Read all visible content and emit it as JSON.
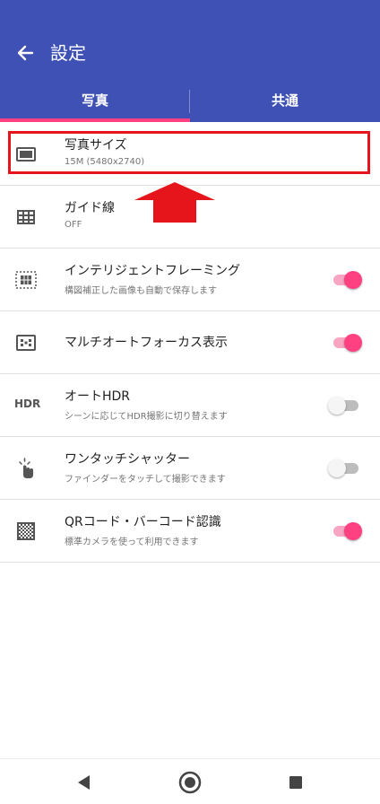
{
  "appbar": {
    "title": "設定",
    "bg_color": "#3f51b5",
    "accent_color": "#ff4081"
  },
  "tabs": [
    {
      "label": "写真",
      "selected": true
    },
    {
      "label": "共通",
      "selected": false
    }
  ],
  "settings": [
    {
      "title": "写真サイズ",
      "subtitle": "15M (5480x2740)",
      "icon": "image-size-icon",
      "toggle": null
    },
    {
      "title": "ガイド線",
      "subtitle": "OFF",
      "icon": "grid-lines-icon",
      "toggle": null
    },
    {
      "title": "インテリジェントフレーミング",
      "subtitle": "構図補正した画像も自動で保存します",
      "icon": "framing-icon",
      "toggle": true
    },
    {
      "title": "マルチオートフォーカス表示",
      "subtitle": "",
      "icon": "multi-af-icon",
      "toggle": true
    },
    {
      "title": "オートHDR",
      "subtitle": "シーンに応じてHDR撮影に切り替えます",
      "icon": "hdr-icon",
      "icon_text": "HDR",
      "toggle": false
    },
    {
      "title": "ワンタッチシャッター",
      "subtitle": "ファインダーをタッチして撮影できます",
      "icon": "touch-shutter-icon",
      "toggle": false
    },
    {
      "title": "QRコード・バーコード認識",
      "subtitle": "標準カメラを使って利用できます",
      "icon": "qr-code-icon",
      "toggle": true
    }
  ],
  "annotation": {
    "highlight_color": "#e5151b"
  },
  "navbar": [
    "back-nav-icon",
    "home-nav-icon",
    "recents-nav-icon"
  ]
}
